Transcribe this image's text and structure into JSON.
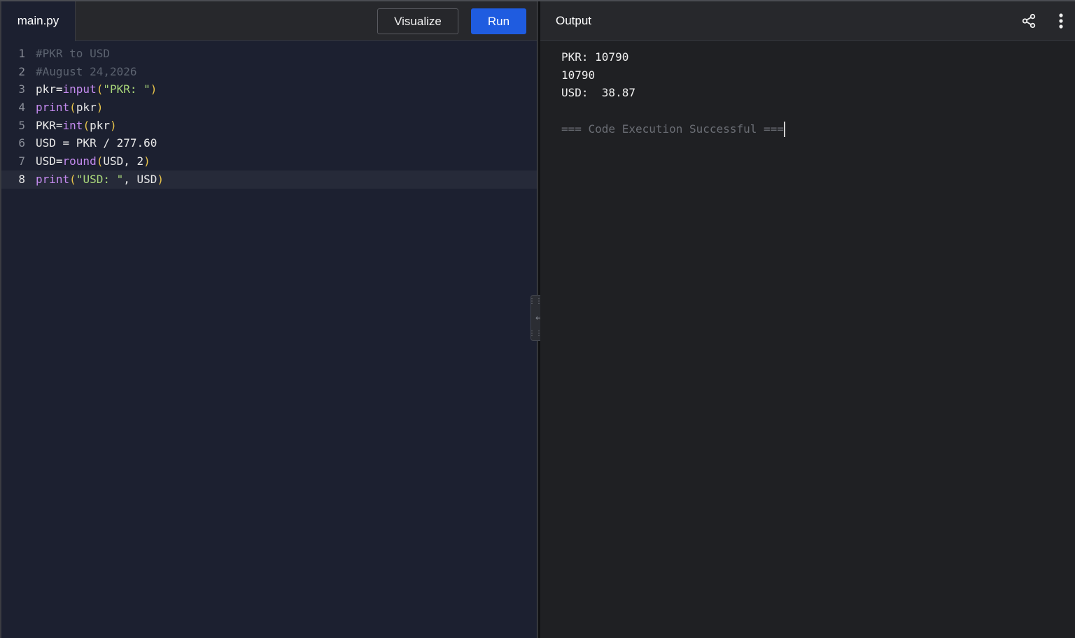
{
  "editor": {
    "file_tab": "main.py",
    "visualize_label": "Visualize",
    "run_label": "Run",
    "lines": [
      {
        "num": "1",
        "tokens": [
          {
            "t": "comment",
            "v": "#PKR to USD"
          }
        ]
      },
      {
        "num": "2",
        "tokens": [
          {
            "t": "comment",
            "v": "#August 24,2026"
          }
        ]
      },
      {
        "num": "3",
        "tokens": [
          {
            "t": "plain",
            "v": "pkr="
          },
          {
            "t": "func",
            "v": "input"
          },
          {
            "t": "paren",
            "v": "("
          },
          {
            "t": "str",
            "v": "\"PKR: \""
          },
          {
            "t": "paren",
            "v": ")"
          }
        ]
      },
      {
        "num": "4",
        "tokens": [
          {
            "t": "func",
            "v": "print"
          },
          {
            "t": "paren",
            "v": "("
          },
          {
            "t": "plain",
            "v": "pkr"
          },
          {
            "t": "paren",
            "v": ")"
          }
        ]
      },
      {
        "num": "5",
        "tokens": [
          {
            "t": "plain",
            "v": "PKR="
          },
          {
            "t": "func",
            "v": "int"
          },
          {
            "t": "paren",
            "v": "("
          },
          {
            "t": "plain",
            "v": "pkr"
          },
          {
            "t": "paren",
            "v": ")"
          }
        ]
      },
      {
        "num": "6",
        "tokens": [
          {
            "t": "plain",
            "v": "USD = PKR / "
          },
          {
            "t": "num",
            "v": "277.60"
          }
        ]
      },
      {
        "num": "7",
        "tokens": [
          {
            "t": "plain",
            "v": "USD="
          },
          {
            "t": "func",
            "v": "round"
          },
          {
            "t": "paren",
            "v": "("
          },
          {
            "t": "plain",
            "v": "USD, "
          },
          {
            "t": "num",
            "v": "2"
          },
          {
            "t": "paren",
            "v": ")"
          }
        ]
      },
      {
        "num": "8",
        "active": true,
        "tokens": [
          {
            "t": "func",
            "v": "print"
          },
          {
            "t": "paren",
            "v": "("
          },
          {
            "t": "str",
            "v": "\"USD: \""
          },
          {
            "t": "plain",
            "v": ", USD"
          },
          {
            "t": "paren",
            "v": ")"
          }
        ]
      }
    ]
  },
  "output": {
    "title": "Output",
    "lines": [
      "PKR: 10790",
      "10790",
      "USD:  38.87",
      ""
    ],
    "status": "=== Code Execution Successful ==="
  },
  "icons": {
    "share": "share-icon",
    "more": "more-vertical-icon",
    "resize": "drag-resize-icon"
  }
}
